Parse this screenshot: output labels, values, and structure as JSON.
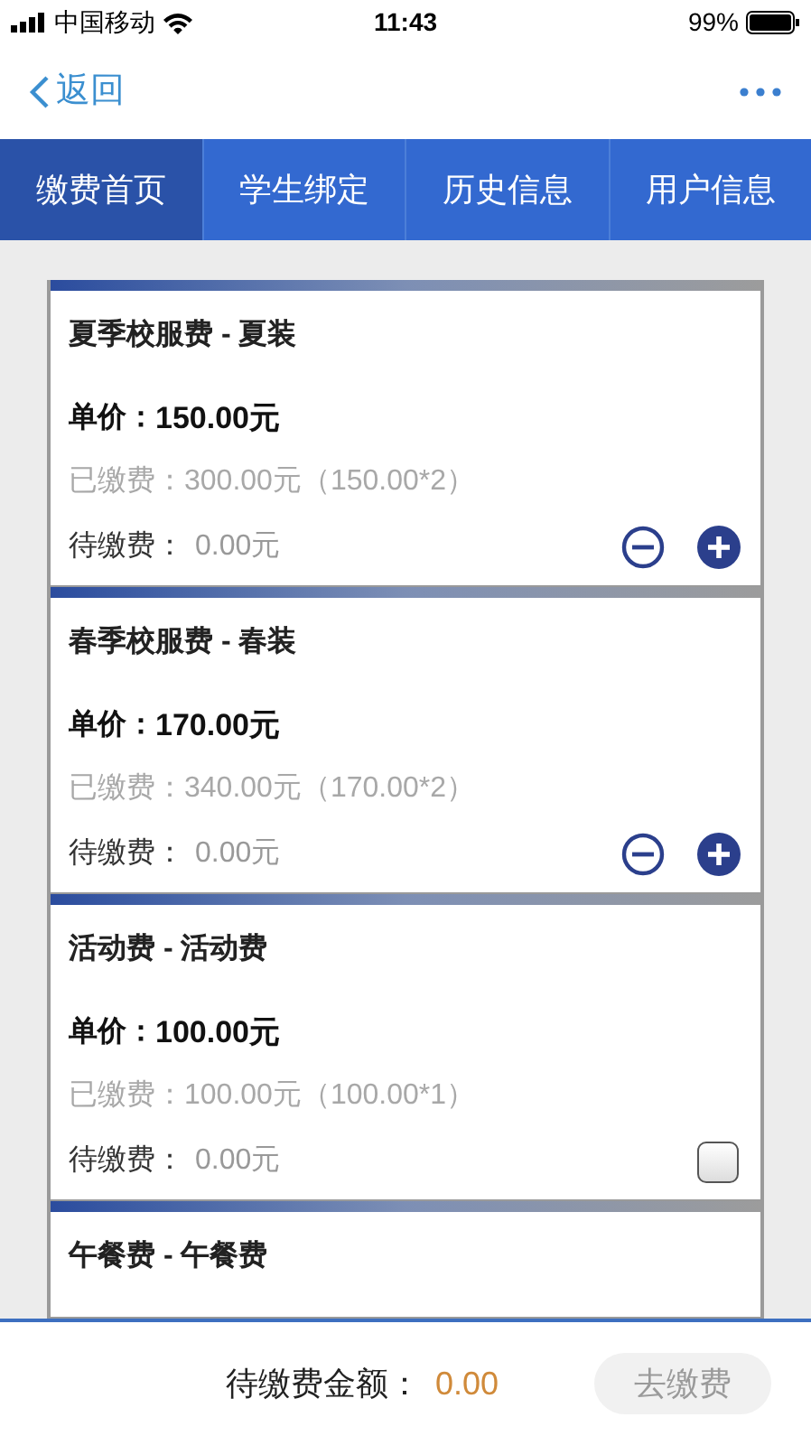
{
  "status_bar": {
    "carrier": "中国移动",
    "time": "11:43",
    "battery": "99%"
  },
  "nav": {
    "back": "返回"
  },
  "tabs": [
    {
      "label": "缴费首页",
      "selected": true
    },
    {
      "label": "学生绑定",
      "selected": false
    },
    {
      "label": "历史信息",
      "selected": false
    },
    {
      "label": "用户信息",
      "selected": false
    }
  ],
  "items": [
    {
      "kind": "stepper",
      "title": "夏季校服费 - 夏装",
      "price_label": "单价：",
      "price": "150.00元",
      "paid": "已缴费：300.00元（150.00*2）",
      "pending_label": "待缴费：",
      "pending": "0.00元"
    },
    {
      "kind": "stepper",
      "title": "春季校服费 - 春装",
      "price_label": "单价：",
      "price": "170.00元",
      "paid": "已缴费：340.00元（170.00*2）",
      "pending_label": "待缴费：",
      "pending": "0.00元"
    },
    {
      "kind": "checkbox",
      "checked": false,
      "title": "活动费 - 活动费",
      "price_label": "单价：",
      "price": "100.00元",
      "paid": "已缴费：100.00元（100.00*1）",
      "pending_label": "待缴费：",
      "pending": "0.00元"
    },
    {
      "kind": "partial",
      "title": "午餐费 - 午餐费"
    }
  ],
  "footer": {
    "total_label": "待缴费金额：",
    "total": "0.00",
    "pay_button": {
      "label": "去缴费",
      "disabled": true
    }
  }
}
